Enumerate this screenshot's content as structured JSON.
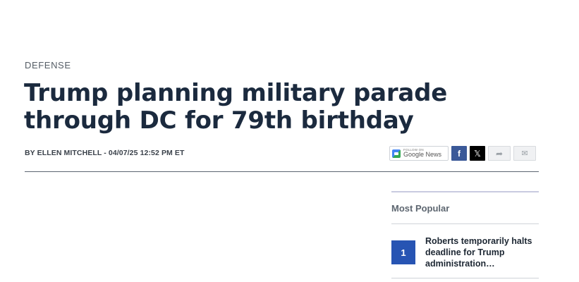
{
  "article": {
    "section": "DEFENSE",
    "headline": "Trump planning military parade through DC for 79th birthday",
    "byline": {
      "prefix": "BY ",
      "author": "ELLEN MITCHELL",
      "separator": " - ",
      "timestamp": "04/07/25 12:52 PM ET"
    }
  },
  "share": {
    "google_news_small": "FOLLOW ON",
    "google_news_label": "Google News",
    "facebook_glyph": "f",
    "x_glyph": "𝕏",
    "share_glyph": "➦",
    "email_glyph": "✉",
    "icons": [
      "google-news-icon",
      "facebook-icon",
      "x-icon",
      "share-icon",
      "email-icon"
    ]
  },
  "most_popular": {
    "title": "Most Popular",
    "items": [
      {
        "rank": "1",
        "text": "Roberts temporarily halts deadline for Trump administration…"
      }
    ]
  },
  "colors": {
    "headline": "#1b2a3e",
    "rank_badge": "#2754b3",
    "facebook": "#3b5998"
  }
}
